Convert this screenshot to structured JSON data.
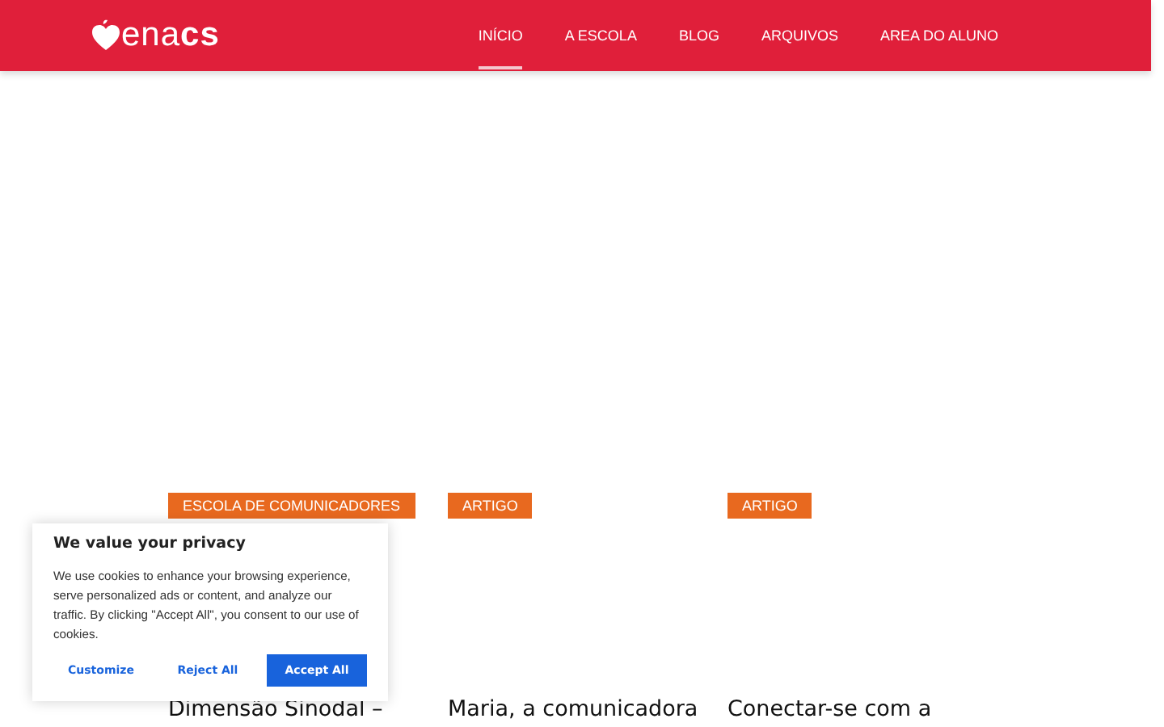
{
  "header": {
    "logo": "ena**cs**",
    "nav": [
      {
        "label": "INÍCIO",
        "selected": true
      },
      {
        "label": "A ESCOLA",
        "selected": false
      },
      {
        "label": "BLOG",
        "selected": false
      },
      {
        "label": "ARQUIVOS",
        "selected": false
      },
      {
        "label": "AREA DO ALUNO",
        "selected": false
      }
    ]
  },
  "posts": [
    {
      "tag": "ESCOLA DE COMUNICADORES",
      "title": "Dimensão Sinodal –"
    },
    {
      "tag": "ARTIGO",
      "title": "Maria, a comunicadora"
    },
    {
      "tag": "ARTIGO",
      "title": "Conectar-se com a"
    }
  ],
  "cookie_banner": {
    "title": "We value your privacy",
    "text": "We use cookies to enhance your browsing experience, serve personalized ads or content, and analyze our traffic. By clicking \"Accept All\", you consent to our use of cookies.",
    "buttons": [
      {
        "label": "Customize",
        "kind": "link"
      },
      {
        "label": "Reject All",
        "kind": "link"
      },
      {
        "label": "Accept All",
        "kind": "primary"
      }
    ]
  }
}
